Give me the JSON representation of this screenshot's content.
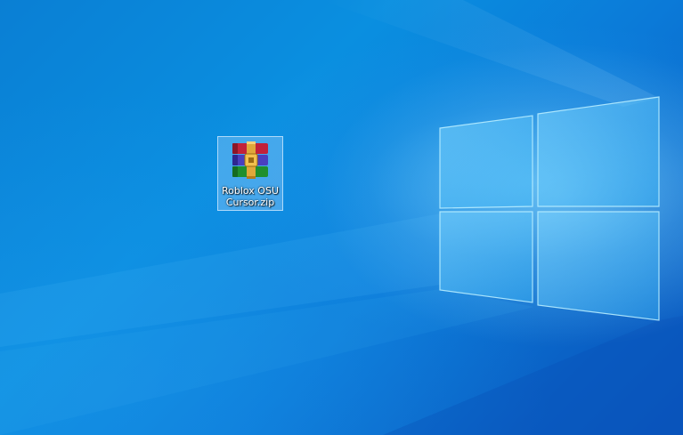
{
  "desktop": {
    "background": "windows-10-hero-wallpaper",
    "accent_color": "#0a8fe0"
  },
  "icons": [
    {
      "label": "Roblox OSU Cursor.zip",
      "icon": "winrar-archive-icon",
      "selected": true
    }
  ]
}
